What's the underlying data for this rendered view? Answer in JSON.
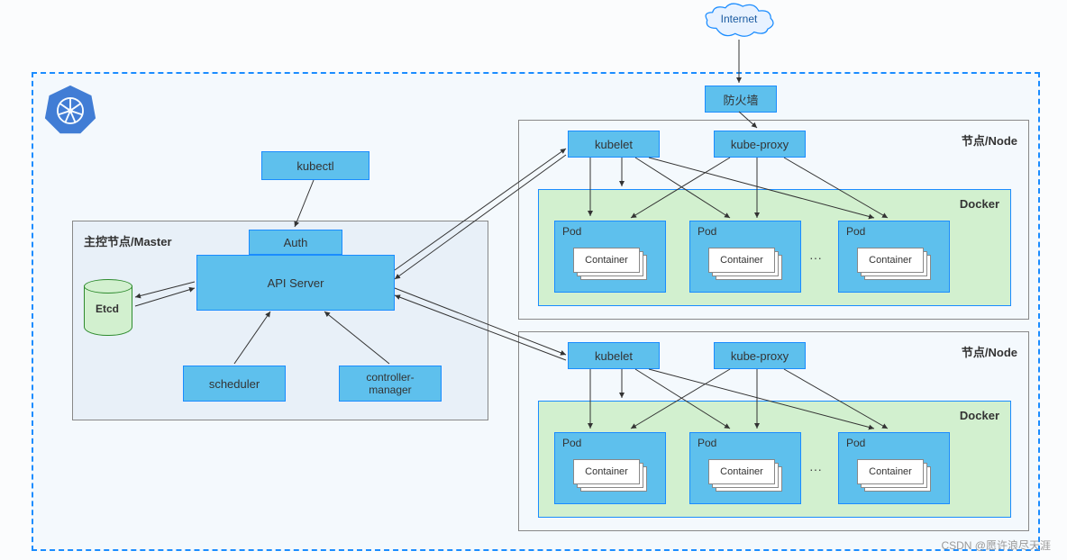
{
  "internet": "Internet",
  "firewall": "防火墙",
  "kubectl": "kubectl",
  "master": {
    "title": "主控节点/Master",
    "auth": "Auth",
    "api_server": "API Server",
    "etcd": "Etcd",
    "scheduler": "scheduler",
    "controller_manager": "controller-\nmanager"
  },
  "node": {
    "title": "节点/Node",
    "kubelet": "kubelet",
    "kube_proxy": "kube-proxy",
    "docker": "Docker",
    "pod": "Pod",
    "container": "Container",
    "dots": "···"
  },
  "watermark": "CSDN @愿许浪尽天涯"
}
